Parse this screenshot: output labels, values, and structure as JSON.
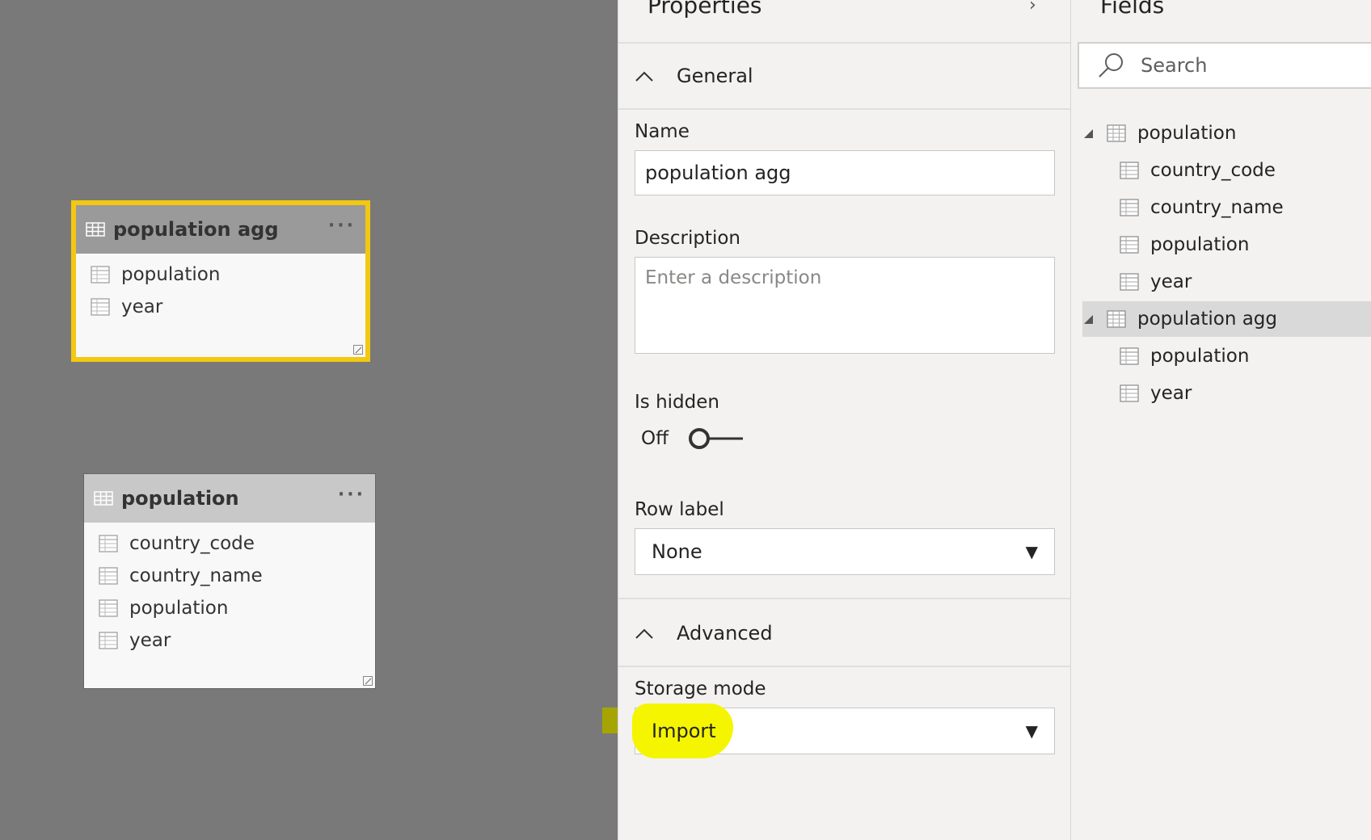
{
  "canvas": {
    "tables": [
      {
        "title": "population agg",
        "more": "···",
        "columns": [
          "population",
          "year"
        ]
      },
      {
        "title": "population",
        "more": "···",
        "columns": [
          "country_code",
          "country_name",
          "population",
          "year"
        ]
      }
    ]
  },
  "properties": {
    "title": "Properties",
    "collapse_glyph": "›",
    "general": {
      "header": "General",
      "name_label": "Name",
      "name_value": "population agg",
      "description_label": "Description",
      "description_placeholder": "Enter a description",
      "is_hidden_label": "Is hidden",
      "is_hidden_state": "Off",
      "row_label_label": "Row label",
      "row_label_value": "None"
    },
    "advanced": {
      "header": "Advanced",
      "storage_mode_label": "Storage mode",
      "storage_mode_value": "Import"
    },
    "dropdown_caret": "▼"
  },
  "fields": {
    "title": "Fields",
    "search_placeholder": "Search",
    "tree": [
      {
        "label": "population",
        "level": 0,
        "expanded": true
      },
      {
        "label": "country_code",
        "level": 1
      },
      {
        "label": "country_name",
        "level": 1
      },
      {
        "label": "population",
        "level": 1
      },
      {
        "label": "year",
        "level": 1
      },
      {
        "label": "population agg",
        "level": 0,
        "expanded": true,
        "selected": true
      },
      {
        "label": "population",
        "level": 1
      },
      {
        "label": "year",
        "level": 1
      }
    ]
  },
  "colors": {
    "selection_border": "#f2c811",
    "highlight": "#f5f500",
    "canvas_bg": "#797979"
  }
}
